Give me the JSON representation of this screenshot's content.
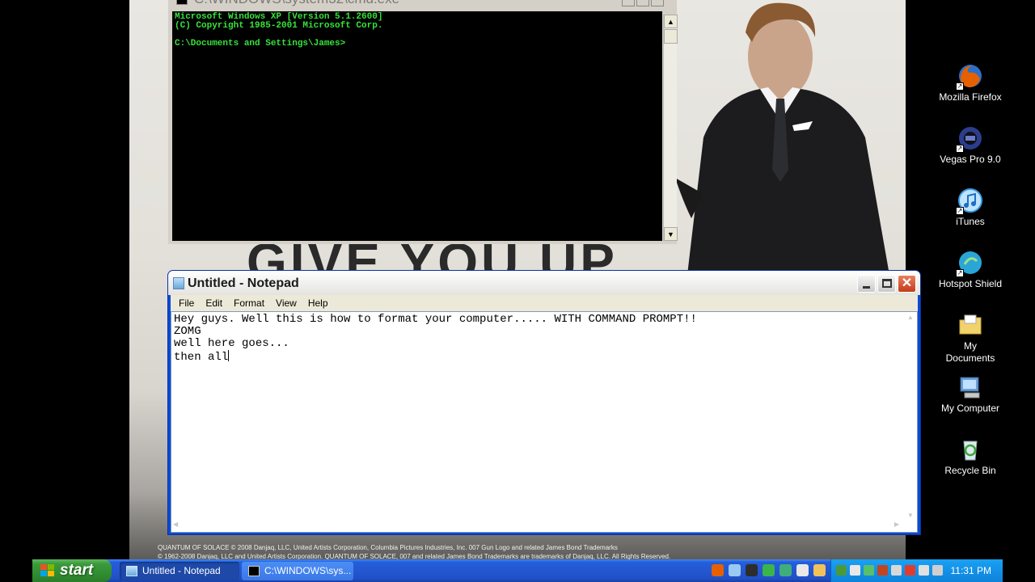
{
  "wallpaper": {
    "headline": "GIVE YOU UP",
    "copyright_lines": [
      "QUANTUM OF SOLACE © 2008 Danjaq, LLC, United Artists Corporation, Columbia Pictures Industries, Inc. 007 Gun Logo and related James Bond Trademarks",
      "© 1962-2008 Danjaq, LLC and United Artists Corporation. QUANTUM OF SOLACE, 007 and related James Bond Trademarks are trademarks of Danjaq, LLC. All Rights Reserved."
    ]
  },
  "cmd": {
    "title": "C:\\WINDOWS\\system32\\cmd.exe",
    "lines": [
      "Microsoft Windows XP [Version 5.1.2600]",
      "(C) Copyright 1985-2001 Microsoft Corp.",
      "",
      "C:\\Documents and Settings\\James>"
    ]
  },
  "notepad": {
    "title": "Untitled - Notepad",
    "menu": [
      "File",
      "Edit",
      "Format",
      "View",
      "Help"
    ],
    "lines": [
      "Hey guys. Well this is how to format your computer..... WITH COMMAND PROMPT!!",
      "ZOMG",
      "well here goes...",
      "then all"
    ]
  },
  "desktop_icons": [
    {
      "label": "Mozilla Firefox",
      "icon": "firefox-icon",
      "color": "#e66000"
    },
    {
      "label": "Vegas Pro 9.0",
      "icon": "vegas-icon",
      "color": "#2b3d8c"
    },
    {
      "label": "iTunes",
      "icon": "itunes-icon",
      "color": "#3a9be8"
    },
    {
      "label": "Hotspot Shield",
      "icon": "hotspot-shield-icon",
      "color": "#2aa6d6"
    },
    {
      "label": "My Documents",
      "icon": "folder-icon",
      "color": "#f2d36b"
    },
    {
      "label": "My Computer",
      "icon": "computer-icon",
      "color": "#6a9fd8"
    },
    {
      "label": "Recycle Bin",
      "icon": "recycle-bin-icon",
      "color": "#5fb85f"
    }
  ],
  "taskbar": {
    "start_label": "start",
    "tasks": [
      {
        "label": "Untitled - Notepad",
        "active": true
      },
      {
        "label": "C:\\WINDOWS\\sys...",
        "active": false
      }
    ],
    "clock": "11:31 PM"
  }
}
